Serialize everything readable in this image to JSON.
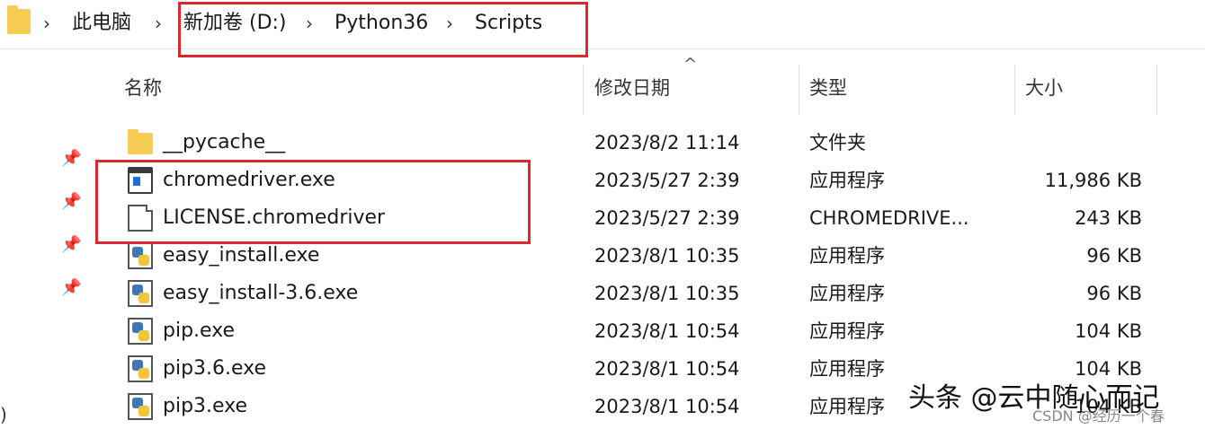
{
  "breadcrumb": {
    "items": [
      "此电脑",
      "新加卷 (D:)",
      "Python36",
      "Scripts"
    ],
    "separator": "›"
  },
  "columns": {
    "name": "名称",
    "date": "修改日期",
    "type": "类型",
    "size": "大小",
    "sort_indicator": "^"
  },
  "files": [
    {
      "name": "__pycache__",
      "date": "2023/8/2 11:14",
      "type": "文件夹",
      "size": "",
      "icon": "folder-icon"
    },
    {
      "name": "chromedriver.exe",
      "date": "2023/5/27 2:39",
      "type": "应用程序",
      "size": "11,986 KB",
      "icon": "exe-icon"
    },
    {
      "name": "LICENSE.chromedriver",
      "date": "2023/5/27 2:39",
      "type": "CHROMEDRIVE...",
      "size": "243 KB",
      "icon": "file-icon"
    },
    {
      "name": "easy_install.exe",
      "date": "2023/8/1 10:35",
      "type": "应用程序",
      "size": "96 KB",
      "icon": "python-icon"
    },
    {
      "name": "easy_install-3.6.exe",
      "date": "2023/8/1 10:35",
      "type": "应用程序",
      "size": "96 KB",
      "icon": "python-icon"
    },
    {
      "name": "pip.exe",
      "date": "2023/8/1 10:54",
      "type": "应用程序",
      "size": "104 KB",
      "icon": "python-icon"
    },
    {
      "name": "pip3.6.exe",
      "date": "2023/8/1 10:54",
      "type": "应用程序",
      "size": "104 KB",
      "icon": "python-icon"
    },
    {
      "name": "pip3.exe",
      "date": "2023/8/1 10:54",
      "type": "应用程序",
      "size": "104 KB",
      "icon": "python-icon"
    }
  ],
  "watermark": "头条 @云中随心而记",
  "watermark_small": "CSDN @经历一个春",
  "edge_glyph": ")",
  "colors": {
    "highlight_box": "#d9282f",
    "folder": "#f6cc55"
  }
}
